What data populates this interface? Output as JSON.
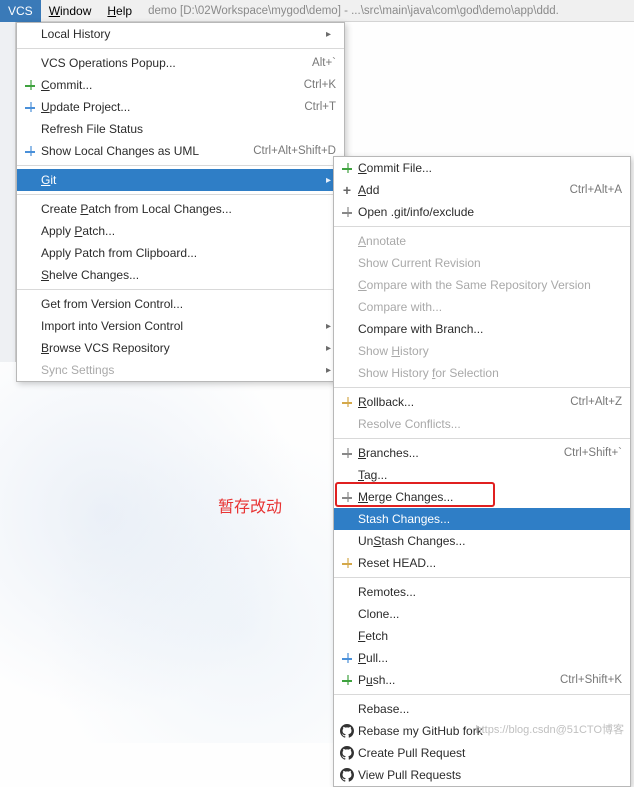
{
  "menubar": {
    "active": "VCS",
    "items": [
      "Window",
      "Help"
    ],
    "path": "demo [D:\\02Workspace\\mygod\\demo] - ...\\src\\main\\java\\com\\god\\demo\\app\\ddd."
  },
  "dropdown": {
    "items": [
      {
        "label": "Local History",
        "arrow": true
      },
      {
        "label": "VCS Operations Popup...",
        "shortcut": "Alt+`"
      },
      {
        "label": "Commit...",
        "shortcut": "Ctrl+K",
        "iconColor": "#3fa23f",
        "ul": 0
      },
      {
        "label": "Update Project...",
        "shortcut": "Ctrl+T",
        "iconColor": "#4a90d9",
        "ul": 0
      },
      {
        "label": "Refresh File Status"
      },
      {
        "label": "Show Local Changes as UML",
        "shortcut": "Ctrl+Alt+Shift+D",
        "iconColor": "#4a90d9"
      },
      {
        "label": "Git",
        "arrow": true,
        "highlighted": true,
        "ul": 0
      },
      {
        "label": "Create Patch from Local Changes...",
        "ul": 7
      },
      {
        "label": "Apply Patch...",
        "ul": 6
      },
      {
        "label": "Apply Patch from Clipboard..."
      },
      {
        "label": "Shelve Changes...",
        "ul": 0
      },
      {
        "label": "Get from Version Control..."
      },
      {
        "label": "Import into Version Control",
        "arrow": true
      },
      {
        "label": "Browse VCS Repository",
        "arrow": true,
        "ul": 0
      },
      {
        "label": "Sync Settings",
        "arrow": true,
        "disabled": true
      }
    ],
    "separators_after": [
      0,
      5,
      6,
      10
    ]
  },
  "submenu": {
    "items": [
      {
        "label": "Commit File...",
        "iconColor": "#3fa23f",
        "ul": 0
      },
      {
        "label": "Add",
        "shortcut": "Ctrl+Alt+A",
        "iconSign": "+",
        "ul": 0
      },
      {
        "label": "Open .git/info/exclude",
        "iconColor": "#888"
      },
      {
        "label": "Annotate",
        "disabled": true,
        "ul": 0
      },
      {
        "label": "Show Current Revision",
        "disabled": true
      },
      {
        "label": "Compare with the Same Repository Version",
        "disabled": true,
        "ul": 0
      },
      {
        "label": "Compare with...",
        "disabled": true
      },
      {
        "label": "Compare with Branch..."
      },
      {
        "label": "Show History",
        "disabled": true,
        "ul": 5
      },
      {
        "label": "Show History for Selection",
        "disabled": true,
        "ul": 13
      },
      {
        "label": "Rollback...",
        "shortcut": "Ctrl+Alt+Z",
        "iconColor": "#d4a84a",
        "ul": 0
      },
      {
        "label": "Resolve Conflicts...",
        "disabled": true
      },
      {
        "label": "Branches...",
        "shortcut": "Ctrl+Shift+`",
        "iconColor": "#888",
        "ul": 0
      },
      {
        "label": "Tag...",
        "ul": 0
      },
      {
        "label": "Merge Changes...",
        "iconColor": "#888",
        "ul": 0
      },
      {
        "label": "Stash Changes...",
        "highlighted": true
      },
      {
        "label": "UnStash Changes...",
        "ul": 2
      },
      {
        "label": "Reset HEAD...",
        "iconColor": "#d4a84a"
      },
      {
        "label": "Remotes..."
      },
      {
        "label": "Clone..."
      },
      {
        "label": "Fetch",
        "ul": 0
      },
      {
        "label": "Pull...",
        "iconColor": "#4a90d9",
        "ul": 0
      },
      {
        "label": "Push...",
        "shortcut": "Ctrl+Shift+K",
        "iconColor": "#3fa23f",
        "ul": 1
      },
      {
        "label": "Rebase..."
      },
      {
        "label": "Rebase my GitHub fork",
        "iconGH": true
      },
      {
        "label": "Create Pull Request",
        "iconGH": true
      },
      {
        "label": "View Pull Requests",
        "iconGH": true
      }
    ],
    "separators_after": [
      2,
      9,
      11,
      17,
      22
    ]
  },
  "annotation": "暂存改动",
  "watermark": "https://blog.csdn@51CTO博客"
}
